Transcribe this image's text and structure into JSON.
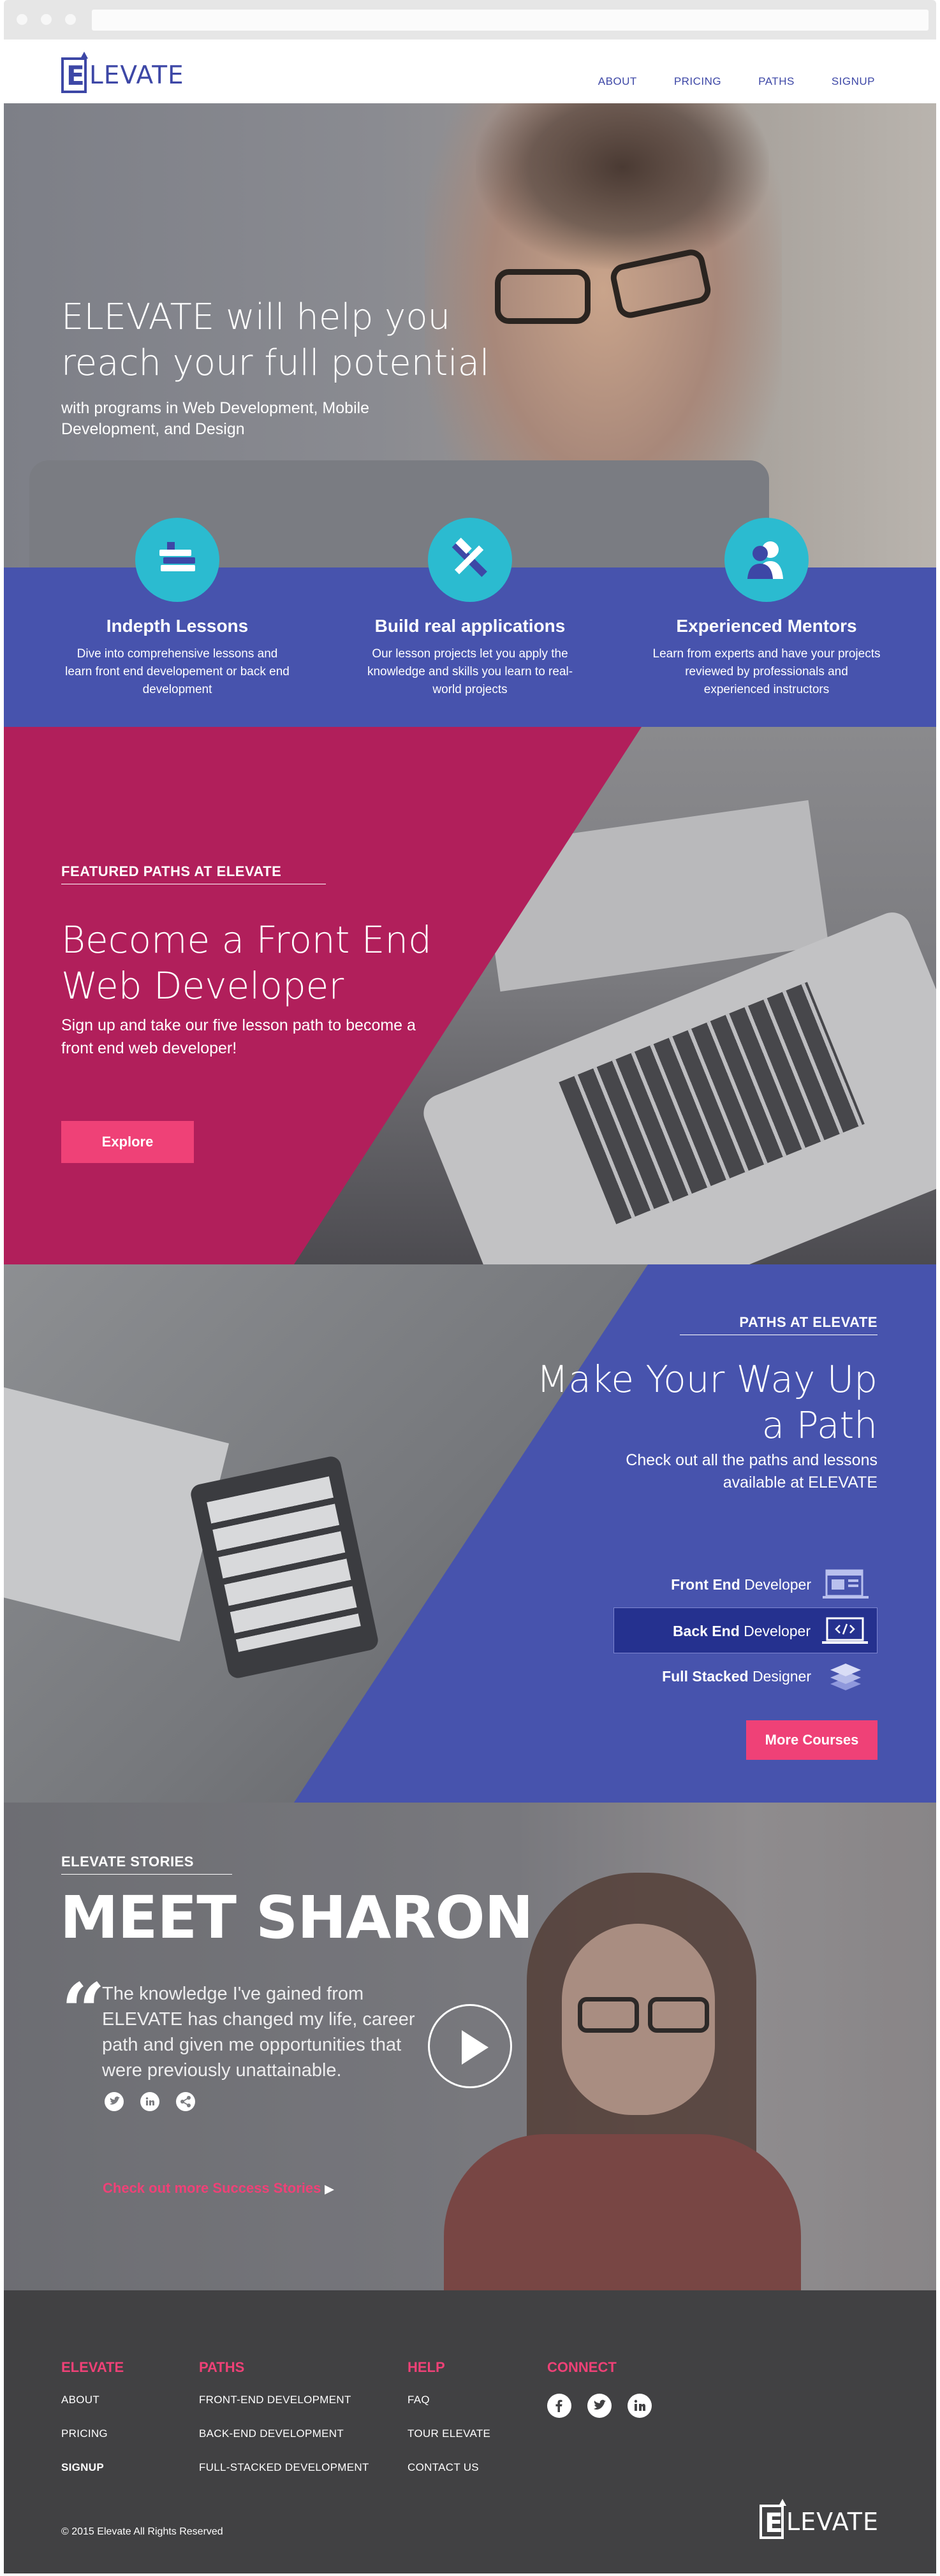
{
  "header": {
    "logo_text": "LEVATE",
    "logo_letter": "E",
    "nav": [
      "ABOUT",
      "PRICING",
      "PATHS",
      "SIGNUP"
    ]
  },
  "hero": {
    "title": "ELEVATE will help you reach your full potential",
    "subtitle": "with programs in Web Development, Mobile Development, and Design"
  },
  "features": [
    {
      "icon": "books-icon",
      "title": "Indepth Lessons",
      "desc": "Dive into comprehensive lessons and learn front end developement or back end development"
    },
    {
      "icon": "tools-icon",
      "title": "Build real applications",
      "desc": "Our lesson projects let you apply the knowledge and skills you learn to real-world projects"
    },
    {
      "icon": "mentors-icon",
      "title": "Experienced Mentors",
      "desc": "Learn from experts and have your projects reviewed by professionals and experienced instructors"
    }
  ],
  "featured": {
    "kicker": "FEATURED PATHS AT ELEVATE",
    "title": "Become a Front End Web Developer",
    "desc": "Sign up and take our five lesson path to become a front end web developer!",
    "button": "Explore"
  },
  "paths": {
    "kicker": "PATHS AT ELEVATE",
    "title": "Make Your Way Up a Path",
    "desc": "Check out all the paths and lessons available at ELEVATE",
    "items": [
      {
        "bold": "Front End",
        "rest": "Developer",
        "icon": "browser-window-icon",
        "active": false
      },
      {
        "bold": "Back End",
        "rest": "Developer",
        "icon": "code-laptop-icon",
        "active": true
      },
      {
        "bold": "Full Stacked",
        "rest": "Designer",
        "icon": "layers-icon",
        "active": false
      }
    ],
    "button": "More Courses"
  },
  "stories": {
    "kicker": "ELEVATE STORIES",
    "title": "MEET SHARON",
    "quote_mark": "“",
    "quote": "The knowledge I've gained from ELEVATE has changed my life, career path and given me opportunities that were previously unattainable.",
    "link": "Check out more Success Stories",
    "link_chevron": "▶"
  },
  "footer": {
    "columns": [
      {
        "heading": "ELEVATE",
        "links": [
          "ABOUT",
          "PRICING",
          "SIGNUP"
        ]
      },
      {
        "heading": "PATHS",
        "links": [
          "FRONT-END DEVELOPMENT",
          "BACK-END DEVELOPMENT",
          "FULL-STACKED DEVELOPMENT"
        ]
      },
      {
        "heading": "HELP",
        "links": [
          "FAQ",
          "TOUR ELEVATE",
          "CONTACT US"
        ]
      },
      {
        "heading": "CONNECT",
        "links": []
      }
    ],
    "copyright": "© 2015 Elevate All Rights Reserved",
    "logo_text": "LEVATE",
    "logo_letter": "E"
  },
  "colors": {
    "brand_blue": "#4753ad",
    "dark_blue": "#25318f",
    "magenta": "#b11f5b",
    "pink": "#ef4177",
    "teal": "#2bbbd0",
    "footer_bg": "#414143"
  }
}
